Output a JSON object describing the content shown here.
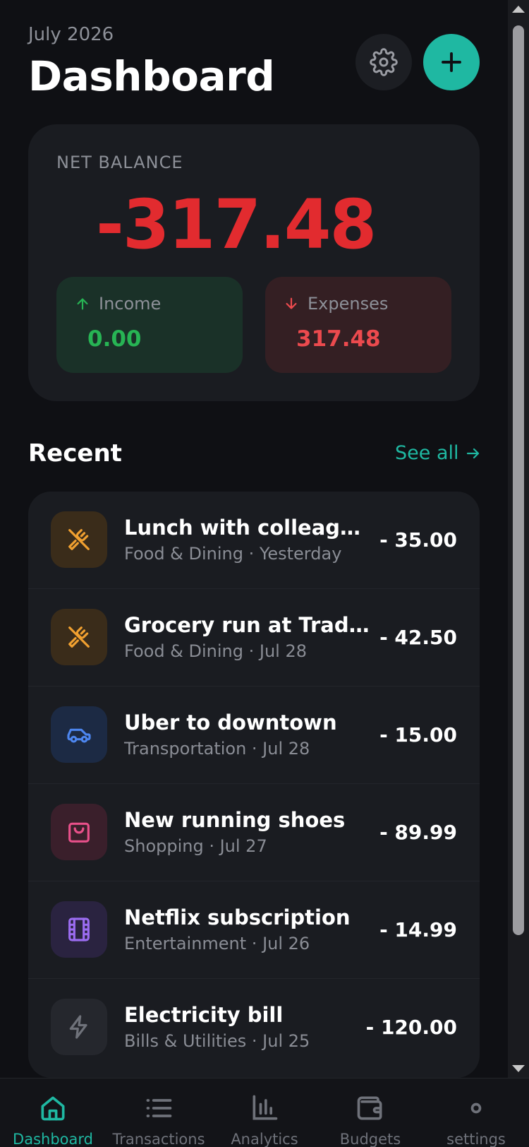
{
  "header": {
    "month": "July 2026",
    "title": "Dashboard"
  },
  "balance": {
    "label": "NET BALANCE",
    "value": "-317.48",
    "income_label": "Income",
    "income_value": "0.00",
    "expenses_label": "Expenses",
    "expenses_value": "317.48"
  },
  "recent": {
    "title": "Recent",
    "see_all": "See all",
    "items": [
      {
        "title": "Lunch with colleagues",
        "subtitle": "Food & Dining · Yesterday",
        "amount": "-  35.00",
        "icon": "fork-knife-icon"
      },
      {
        "title": "Grocery run at Trader Joe's",
        "subtitle": "Food & Dining · Jul 28",
        "amount": "-  42.50",
        "icon": "fork-knife-icon"
      },
      {
        "title": "Uber to downtown",
        "subtitle": "Transportation · Jul 28",
        "amount": "-  15.00",
        "icon": "car-icon"
      },
      {
        "title": "New running shoes",
        "subtitle": "Shopping · Jul 27",
        "amount": "-  89.99",
        "icon": "shopping-bag-icon"
      },
      {
        "title": "Netflix subscription",
        "subtitle": "Entertainment · Jul 26",
        "amount": "-  14.99",
        "icon": "film-icon"
      },
      {
        "title": "Electricity bill",
        "subtitle": "Bills & Utilities · Jul 25",
        "amount": "-  120.00",
        "icon": "lightning-icon"
      }
    ]
  },
  "nav": {
    "items": [
      {
        "label": "Dashboard",
        "icon": "home-icon",
        "active": true
      },
      {
        "label": "Transactions",
        "icon": "list-icon"
      },
      {
        "label": "Analytics",
        "icon": "bar-chart-icon"
      },
      {
        "label": "Budgets",
        "icon": "wallet-icon"
      },
      {
        "label": "settings",
        "icon": "settings-icon"
      }
    ]
  },
  "colors": {
    "accent": "#1fb8a2",
    "negative": "#e22b2f",
    "positive": "#27b454",
    "food": "#f0a030",
    "transport": "#4d86ef",
    "shopping": "#e8508a",
    "entertainment": "#9b6cf0",
    "bills": "#6f727a"
  }
}
